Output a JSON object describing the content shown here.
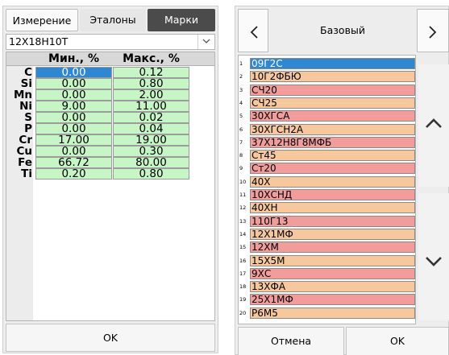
{
  "left": {
    "tabs": [
      "Измерение",
      "Эталоны",
      "Марки"
    ],
    "active_tab": "Марки",
    "grade_selected": "12Х18Н10Т",
    "table": {
      "columns": [
        "Мин., %",
        "Макс., %"
      ],
      "rows": [
        {
          "el": "C",
          "min": "0.00",
          "max": "0.12"
        },
        {
          "el": "Si",
          "min": "0.00",
          "max": "0.80"
        },
        {
          "el": "Mn",
          "min": "0.00",
          "max": "2.00"
        },
        {
          "el": "Ni",
          "min": "9.00",
          "max": "11.00"
        },
        {
          "el": "S",
          "min": "0.00",
          "max": "0.02"
        },
        {
          "el": "P",
          "min": "0.00",
          "max": "0.04"
        },
        {
          "el": "Cr",
          "min": "17.00",
          "max": "19.00"
        },
        {
          "el": "Cu",
          "min": "0.00",
          "max": "0.30"
        },
        {
          "el": "Fe",
          "min": "66.72",
          "max": "80.00"
        },
        {
          "el": "Ti",
          "min": "0.20",
          "max": "0.80"
        }
      ]
    },
    "ok_label": "OK"
  },
  "right": {
    "title": "Базовый",
    "items": [
      {
        "n": "1",
        "name": "09Г2С",
        "state": "selected"
      },
      {
        "n": "2",
        "name": "10Г2ФБЮ",
        "state": "orange"
      },
      {
        "n": "3",
        "name": "СЧ20",
        "state": "red"
      },
      {
        "n": "4",
        "name": "СЧ25",
        "state": "orange"
      },
      {
        "n": "5",
        "name": "30ХГСА",
        "state": "red"
      },
      {
        "n": "6",
        "name": "30ХГСН2А",
        "state": "orange"
      },
      {
        "n": "7",
        "name": "37Х12Н8Г8МФБ",
        "state": "red"
      },
      {
        "n": "8",
        "name": "Ст45",
        "state": "orange"
      },
      {
        "n": "9",
        "name": "Ст20",
        "state": "red"
      },
      {
        "n": "10",
        "name": "40Х",
        "state": "orange"
      },
      {
        "n": "11",
        "name": "10ХСНД",
        "state": "red"
      },
      {
        "n": "12",
        "name": "40ХН",
        "state": "orange"
      },
      {
        "n": "13",
        "name": "110Г13",
        "state": "red"
      },
      {
        "n": "14",
        "name": "12Х1МФ",
        "state": "orange"
      },
      {
        "n": "15",
        "name": "12ХМ",
        "state": "red"
      },
      {
        "n": "16",
        "name": "15Х5М",
        "state": "orange"
      },
      {
        "n": "17",
        "name": "9ХС",
        "state": "red"
      },
      {
        "n": "18",
        "name": "13ХФА",
        "state": "orange"
      },
      {
        "n": "19",
        "name": "25Х1МФ",
        "state": "red"
      },
      {
        "n": "20",
        "name": "Р6М5",
        "state": "orange"
      }
    ],
    "cancel_label": "Отмена",
    "ok_label": "OK"
  },
  "icons": {
    "prev": "chevron-left-icon",
    "next": "chevron-right-icon",
    "up": "chevron-up-icon",
    "down": "chevron-down-icon",
    "dropdown": "dropdown-arrow-icon"
  },
  "colors": {
    "selected": "#2f86d1",
    "table_cell": "#c6f6c6",
    "item_orange": "#f7c79e",
    "item_red": "#f29c9c",
    "active_tab": "#4b4b4b"
  }
}
